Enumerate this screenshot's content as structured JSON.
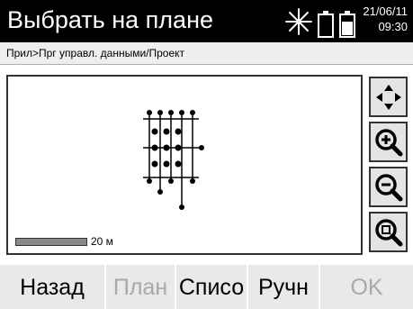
{
  "header": {
    "title": "Выбрать на плане",
    "date": "21/06/11",
    "time": "09:30"
  },
  "breadcrumb": "Прил>Прг управл. данными/Проект",
  "map": {
    "scale_label": "20 м"
  },
  "toolbar": {
    "items": [
      {
        "name": "pan",
        "icon": "pan-arrows-icon"
      },
      {
        "name": "zoom-in",
        "icon": "zoom-in-icon"
      },
      {
        "name": "zoom-out",
        "icon": "zoom-out-icon"
      },
      {
        "name": "zoom-fit",
        "icon": "zoom-fit-icon"
      }
    ]
  },
  "softkeys": {
    "back": "Назад",
    "plan": "План",
    "list": "Списо",
    "manual": "Ручн",
    "ok": "OK"
  },
  "colors": {
    "header_bg": "#000000",
    "disabled_text": "#a8a8a8"
  }
}
